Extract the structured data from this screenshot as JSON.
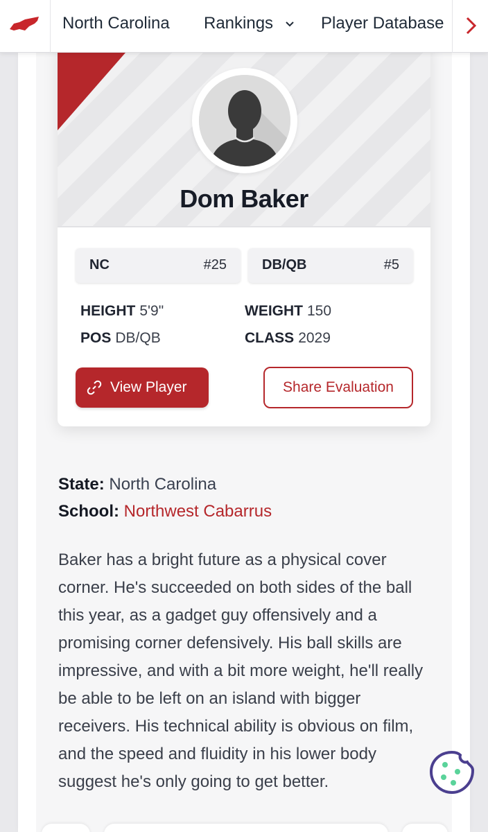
{
  "nav": {
    "items": [
      {
        "label": "North Carolina"
      },
      {
        "label": "Rankings"
      },
      {
        "label": "Player Database"
      }
    ]
  },
  "colors": {
    "accent": "#b5272b",
    "text": "#1f2430"
  },
  "icons": {
    "logo": "nc-state-map-icon",
    "rankings_dropdown": "chevron-down-icon",
    "nav_next": "chevron-right-icon",
    "avatar": "player-silhouette-icon",
    "view_player": "link-icon",
    "cookie": "cookie-icon"
  },
  "player": {
    "name": "Dom Baker",
    "state_code": "NC",
    "state_rank": "#25",
    "position_label": "DB/QB",
    "position_rank": "#5",
    "height_label": "HEIGHT",
    "height": "5'9\"",
    "weight_label": "WEIGHT",
    "weight": "150",
    "pos_label": "POS",
    "pos": "DB/QB",
    "class_label": "CLASS",
    "class_year": "2029"
  },
  "actions": {
    "view_player": "View Player",
    "share": "Share Evaluation"
  },
  "info": {
    "state_label": "State:",
    "state": "North Carolina",
    "school_label": "School:",
    "school": "Northwest Cabarrus"
  },
  "bio": "Baker has a bright future as a physical cover corner. He's succeeded on both sides of the ball this year, as a gadget guy offensively and a promising corner defensively. His ball skills are impressive, and with a bit more weight, he'll really be able to be left on an island with bigger receivers. His technical ability is obvious on film, and the speed and fluidity in his lower body suggest he's only going to get better."
}
